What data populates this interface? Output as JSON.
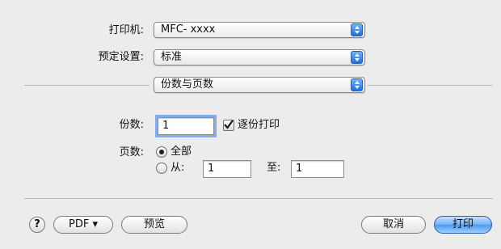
{
  "printer": {
    "label": "打印机:",
    "value": "MFC- xxxx"
  },
  "presets": {
    "label": "预定设置:",
    "value": "标准"
  },
  "section": {
    "value": "份数与页数"
  },
  "copies": {
    "label": "份数:",
    "value": "1",
    "collate_label": "逐份打印",
    "collate_checked": true
  },
  "pages": {
    "label": "页数:",
    "all_label": "全部",
    "all_selected": true,
    "from_label": "从:",
    "from_value": "1",
    "to_label": "至:",
    "to_value": "1"
  },
  "buttons": {
    "help": "?",
    "pdf": "PDF ▾",
    "preview": "预览",
    "cancel": "取消",
    "print": "打印"
  },
  "colors": {
    "accent": "#4b98f0"
  },
  "icons": {
    "popup_arrow": "up-down-arrows-icon",
    "checkbox": "checkmark-icon"
  }
}
